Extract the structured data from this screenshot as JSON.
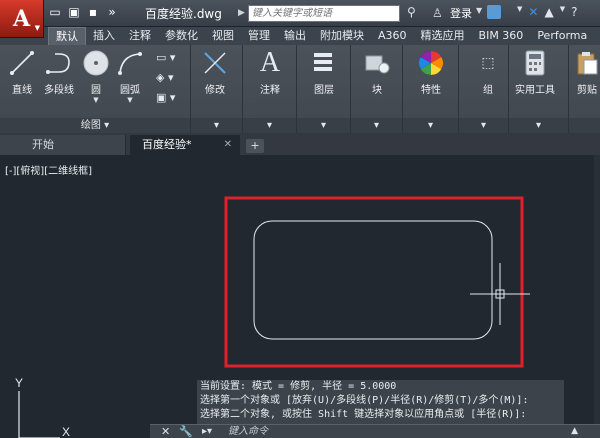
{
  "titlebar": {
    "app_logo": "A",
    "document_title": "百度经验.dwg",
    "search_placeholder": "键入关键字或短语",
    "login": "登录"
  },
  "ribbon_tabs": [
    "默认",
    "插入",
    "注释",
    "参数化",
    "视图",
    "管理",
    "输出",
    "附加模块",
    "A360",
    "精选应用",
    "BIM 360",
    "Performa"
  ],
  "ribbon": {
    "draw_tools": {
      "line": "直线",
      "polyline": "多段线",
      "circle": "圆",
      "arc": "圆弧"
    },
    "draw_panel_label": "绘图",
    "modify": "修改",
    "annotation": "注释",
    "layers": "图层",
    "block": "块",
    "properties": "特性",
    "group": "组",
    "utilities": "实用工具",
    "clipboard": "剪贴"
  },
  "file_tabs": {
    "start": "开始",
    "current": "百度经验*"
  },
  "viewport_label": "[-][俯视][二维线框]",
  "ucs": {
    "y_label": "Y",
    "x_label": "X"
  },
  "command_history": [
    "当前设置: 模式 = 修剪, 半径 = 5.0000",
    "选择第一个对象或 [放弃(U)/多段线(P)/半径(R)/修剪(T)/多个(M)]:",
    "选择第二个对象, 或按住 Shift 键选择对象以应用角点或 [半径(R)]:"
  ],
  "command_input_placeholder": "键入命令",
  "colors": {
    "canvas_bg": "#212830",
    "highlight_box": "#e0202a",
    "geometry": "#e6e9ee",
    "app_button": "#c8321f"
  }
}
